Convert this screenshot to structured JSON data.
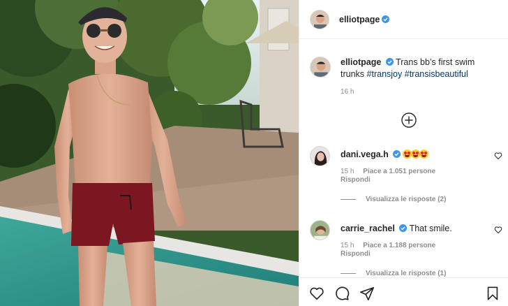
{
  "header": {
    "username": "elliotpage",
    "verified": true
  },
  "caption": {
    "username": "elliotpage",
    "text": "Trans bb’s first swim trunks",
    "hashtags": [
      "#transjoy",
      "#transisbeautiful"
    ],
    "time": "16 h"
  },
  "load_more": {
    "icon": "plus-circle-icon"
  },
  "comments": [
    {
      "username": "dani.vega.h",
      "verified": true,
      "text": "",
      "emojis": [
        "heart-eyes",
        "heart-eyes",
        "heart-eyes"
      ],
      "time": "15 h",
      "likes": "Piace a 1.051 persone",
      "reply": "Rispondi",
      "view_replies": "Visualizza le risposte (2)"
    },
    {
      "username": "carrie_rachel",
      "verified": true,
      "text": "That smile.",
      "time": "15 h",
      "likes": "Piace a 1.188 persone",
      "reply": "Rispondi",
      "view_replies": "Visualizza le risposte (1)"
    }
  ],
  "actions": {
    "like": "heart-icon",
    "comment": "comment-icon",
    "share": "share-icon",
    "save": "bookmark-icon"
  },
  "colors": {
    "text": "#262626",
    "secondary": "#8e8e8e",
    "hashtag": "#00376b",
    "verified": "#3897f0",
    "border": "#efefef"
  }
}
